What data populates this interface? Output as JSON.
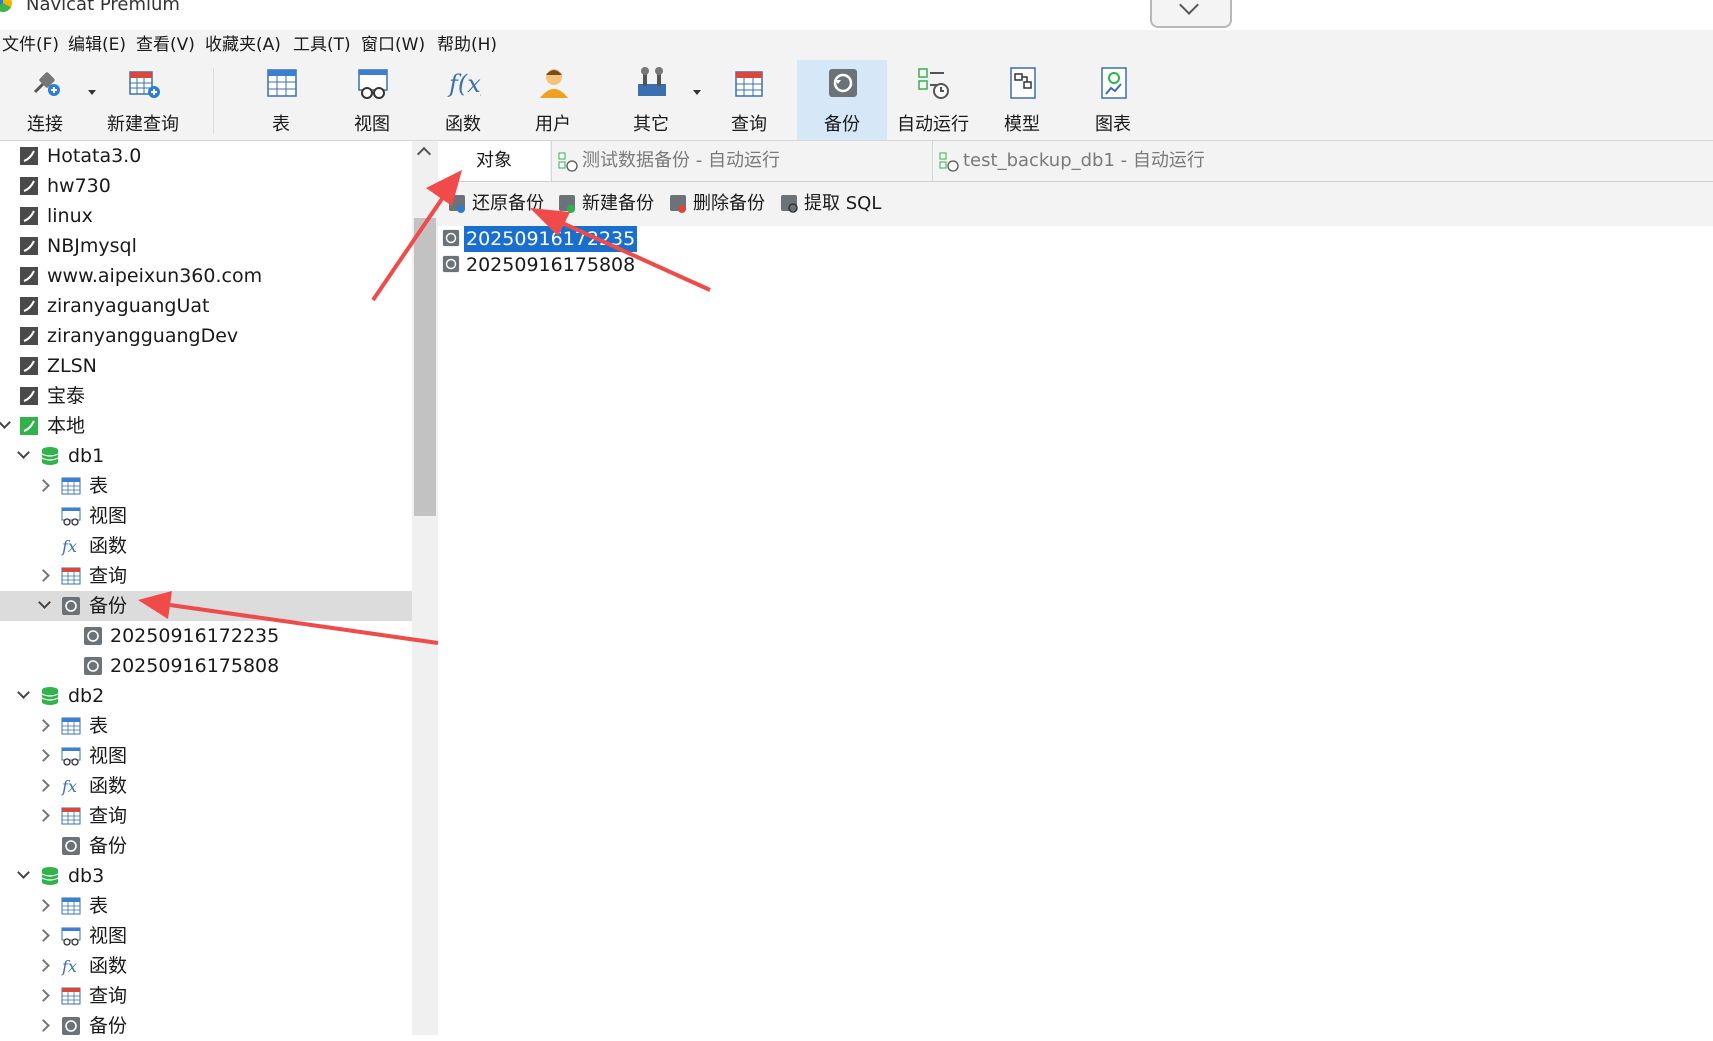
{
  "window": {
    "title": "Navicat Premium"
  },
  "menu": [
    "文件(F)",
    "编辑(E)",
    "查看(V)",
    "收藏夹(A)",
    "工具(T)",
    "窗口(W)",
    "帮助(H)"
  ],
  "toolbar": {
    "connect": "连接",
    "new_query": "新建查询",
    "table": "表",
    "view": "视图",
    "function": "函数",
    "user": "用户",
    "other": "其它",
    "query": "查询",
    "backup": "备份",
    "auto_run": "自动运行",
    "model": "模型",
    "chart": "图表"
  },
  "sidebar": {
    "connections": [
      "Hotata3.0",
      "hw730",
      "linux",
      "NBJmysql",
      "www.aipeixun360.com",
      "ziranyaguangUat",
      "ziranyangguangDev",
      "ZLSN",
      "宝泰"
    ],
    "local": "本地",
    "db1": {
      "name": "db1",
      "table": "表",
      "view": "视图",
      "function": "函数",
      "query": "查询",
      "backup": "备份",
      "backups": [
        "20250916172235",
        "20250916175808"
      ]
    },
    "db2": {
      "name": "db2",
      "table": "表",
      "view": "视图",
      "function": "函数",
      "query": "查询",
      "backup": "备份"
    },
    "db3": {
      "name": "db3",
      "table": "表",
      "view": "视图",
      "function": "函数",
      "query": "查询",
      "backup": "备份"
    }
  },
  "tabs": {
    "objects": "对象",
    "tab1": "测试数据备份 - 自动运行",
    "tab2": "test_backup_db1 - 自动运行"
  },
  "object_toolbar": {
    "restore": "还原备份",
    "new": "新建备份",
    "delete": "删除备份",
    "extract": "提取 SQL"
  },
  "object_list": [
    "20250916172235",
    "20250916175808"
  ],
  "colors": {
    "selection": "#1a6fce",
    "active_tool": "#d6e7f7",
    "annotation_arrow": "#f04a4a",
    "db_icon": "#2fb34a"
  }
}
